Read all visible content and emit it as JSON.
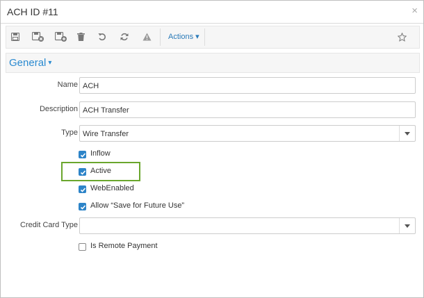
{
  "dialog": {
    "title": "ACH ID #11",
    "close_glyph": "×"
  },
  "toolbar": {
    "icons": [
      "save-icon",
      "save-and-close-icon",
      "save-and-new-icon",
      "delete-icon",
      "undo-icon",
      "refresh-icon",
      "warning-icon",
      "star-icon"
    ],
    "actions_label": "Actions ▾"
  },
  "section": {
    "title": "General",
    "caret": "▾"
  },
  "form": {
    "name": {
      "label": "Name",
      "value": "ACH"
    },
    "description": {
      "label": "Description",
      "value": "ACH Transfer"
    },
    "type": {
      "label": "Type",
      "value": "Wire Transfer"
    },
    "checkboxes": [
      {
        "label": "Inflow",
        "checked": true
      },
      {
        "label": "Active",
        "checked": true
      },
      {
        "label": "WebEnabled",
        "checked": true
      },
      {
        "label": "Allow “Save for Future Use”",
        "checked": true
      }
    ],
    "credit_card_type": {
      "label": "Credit Card Type",
      "value": ""
    },
    "is_remote_payment": {
      "label": "Is Remote Payment",
      "checked": false
    }
  },
  "colors": {
    "accent": "#2a8ad0",
    "checkbox": "#2d84c8",
    "highlight": "#6aa62d"
  }
}
